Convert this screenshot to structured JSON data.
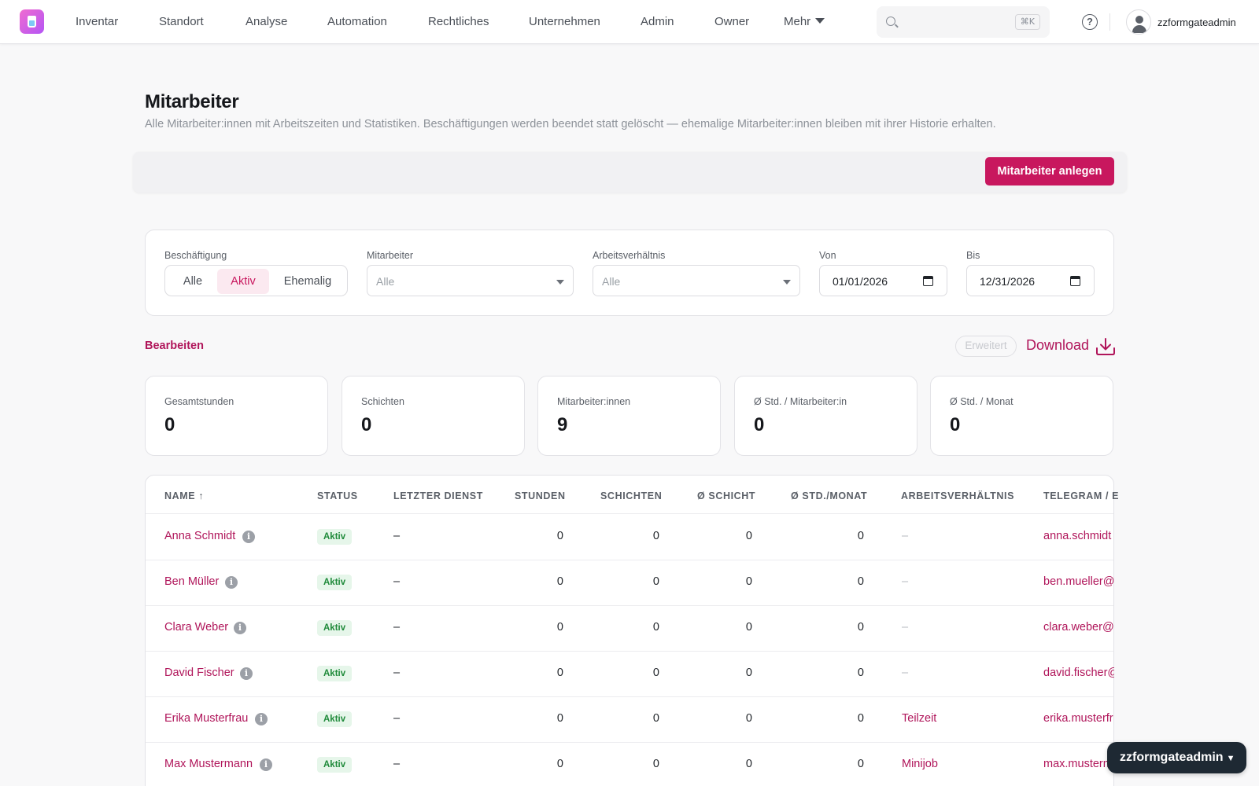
{
  "brand": {
    "accent": "#c8175e",
    "link": "#b0155a",
    "status_green": "#1f8a3a"
  },
  "nav": {
    "items": [
      "Inventar",
      "Standort",
      "Analyse",
      "Automation",
      "Rechtliches",
      "Unternehmen",
      "Admin",
      "Owner",
      "Mehr"
    ],
    "search_shortcut": "⌘K",
    "help_icon": "?",
    "username": "zzformgateadmin"
  },
  "header": {
    "title": "Mitarbeiter",
    "subtitle": "Alle Mitarbeiter:innen mit Arbeitszeiten und Statistiken. Beschäftigungen werden beendet statt gelöscht — ehemalige Mitarbeiter:innen bleiben mit ihrer Historie erhalten.",
    "create_button": "Mitarbeiter anlegen"
  },
  "filters": {
    "employment_label": "Beschäftigung",
    "employment_options": [
      "Alle",
      "Aktiv",
      "Ehemalig"
    ],
    "employment_selected": "Aktiv",
    "employee_label": "Mitarbeiter",
    "employee_value": "Alle",
    "contract_label": "Arbeitsverhältnis",
    "contract_value": "Alle",
    "from_label": "Von",
    "from_value": "01/01/2026",
    "to_label": "Bis",
    "to_value": "12/31/2026"
  },
  "toolbar": {
    "edit": "Bearbeiten",
    "advanced": "Erweitert",
    "download": "Download"
  },
  "stats": [
    {
      "label": "Gesamtstunden",
      "value": "0"
    },
    {
      "label": "Schichten",
      "value": "0"
    },
    {
      "label": "Mitarbeiter:innen",
      "value": "9"
    },
    {
      "label": "Ø Std. / Mitarbeiter:in",
      "value": "0"
    },
    {
      "label": "Ø Std. / Monat",
      "value": "0"
    }
  ],
  "table": {
    "columns": [
      "NAME ↑",
      "STATUS",
      "LETZTER DIENST",
      "STUNDEN",
      "SCHICHTEN",
      "Ø SCHICHT",
      "Ø STD./MONAT",
      "ARBEITSVERHÄLTNIS",
      "TELEGRAM / E"
    ],
    "rows": [
      {
        "name": "Anna Schmidt",
        "status": "Aktiv",
        "last": "–",
        "hours": "0",
        "shifts": "0",
        "avg_shift": "0",
        "avg_month": "0",
        "contract": "–",
        "contact": "anna.schmidt"
      },
      {
        "name": "Ben Müller",
        "status": "Aktiv",
        "last": "–",
        "hours": "0",
        "shifts": "0",
        "avg_shift": "0",
        "avg_month": "0",
        "contract": "–",
        "contact": "ben.mueller@"
      },
      {
        "name": "Clara Weber",
        "status": "Aktiv",
        "last": "–",
        "hours": "0",
        "shifts": "0",
        "avg_shift": "0",
        "avg_month": "0",
        "contract": "–",
        "contact": "clara.weber@"
      },
      {
        "name": "David Fischer",
        "status": "Aktiv",
        "last": "–",
        "hours": "0",
        "shifts": "0",
        "avg_shift": "0",
        "avg_month": "0",
        "contract": "–",
        "contact": "david.fischer@"
      },
      {
        "name": "Erika Musterfrau",
        "status": "Aktiv",
        "last": "–",
        "hours": "0",
        "shifts": "0",
        "avg_shift": "0",
        "avg_month": "0",
        "contract": "Teilzeit",
        "contact": "erika.musterfr"
      },
      {
        "name": "Max Mustermann",
        "status": "Aktiv",
        "last": "–",
        "hours": "0",
        "shifts": "0",
        "avg_shift": "0",
        "avg_month": "0",
        "contract": "Minijob",
        "contact": "max.musterm"
      }
    ]
  },
  "floating_user": "zzformgateadmin"
}
